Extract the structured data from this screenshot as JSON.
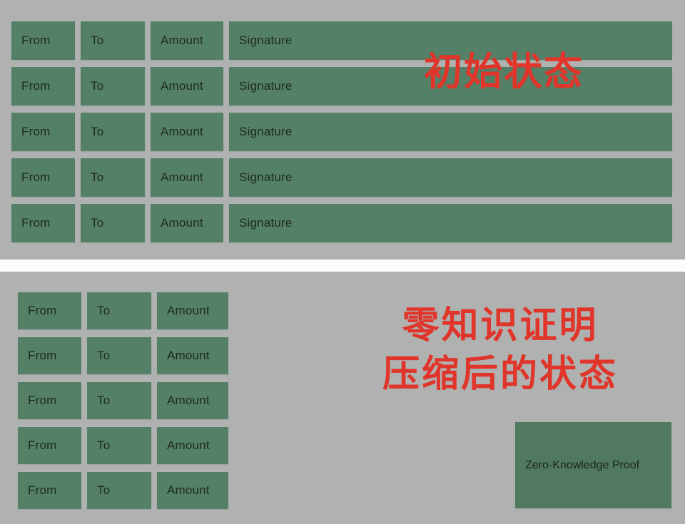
{
  "colors": {
    "background": "#b0b2b1",
    "cell_green": "#548067",
    "annotation_red": "#e0352a",
    "divider": "#fcfcfc",
    "cell_text": "#1d2a22"
  },
  "top_panel": {
    "annotation": "初始状态",
    "columns": [
      "From",
      "To",
      "Amount",
      "Signature"
    ],
    "rows": [
      {
        "from": "From",
        "to": "To",
        "amount": "Amount",
        "signature": "Signature"
      },
      {
        "from": "From",
        "to": "To",
        "amount": "Amount",
        "signature": "Signature"
      },
      {
        "from": "From",
        "to": "To",
        "amount": "Amount",
        "signature": "Signature"
      },
      {
        "from": "From",
        "to": "To",
        "amount": "Amount",
        "signature": "Signature"
      },
      {
        "from": "From",
        "to": "To",
        "amount": "Amount",
        "signature": "Signature"
      }
    ]
  },
  "bottom_panel": {
    "annotation_line1": "零知识证明",
    "annotation_line2": "压缩后的状态",
    "columns": [
      "From",
      "To",
      "Amount"
    ],
    "rows": [
      {
        "from": "From",
        "to": "To",
        "amount": "Amount"
      },
      {
        "from": "From",
        "to": "To",
        "amount": "Amount"
      },
      {
        "from": "From",
        "to": "To",
        "amount": "Amount"
      },
      {
        "from": "From",
        "to": "To",
        "amount": "Amount"
      },
      {
        "from": "From",
        "to": "To",
        "amount": "Amount"
      }
    ],
    "zk_proof_label": "Zero-Knowledge Proof"
  }
}
